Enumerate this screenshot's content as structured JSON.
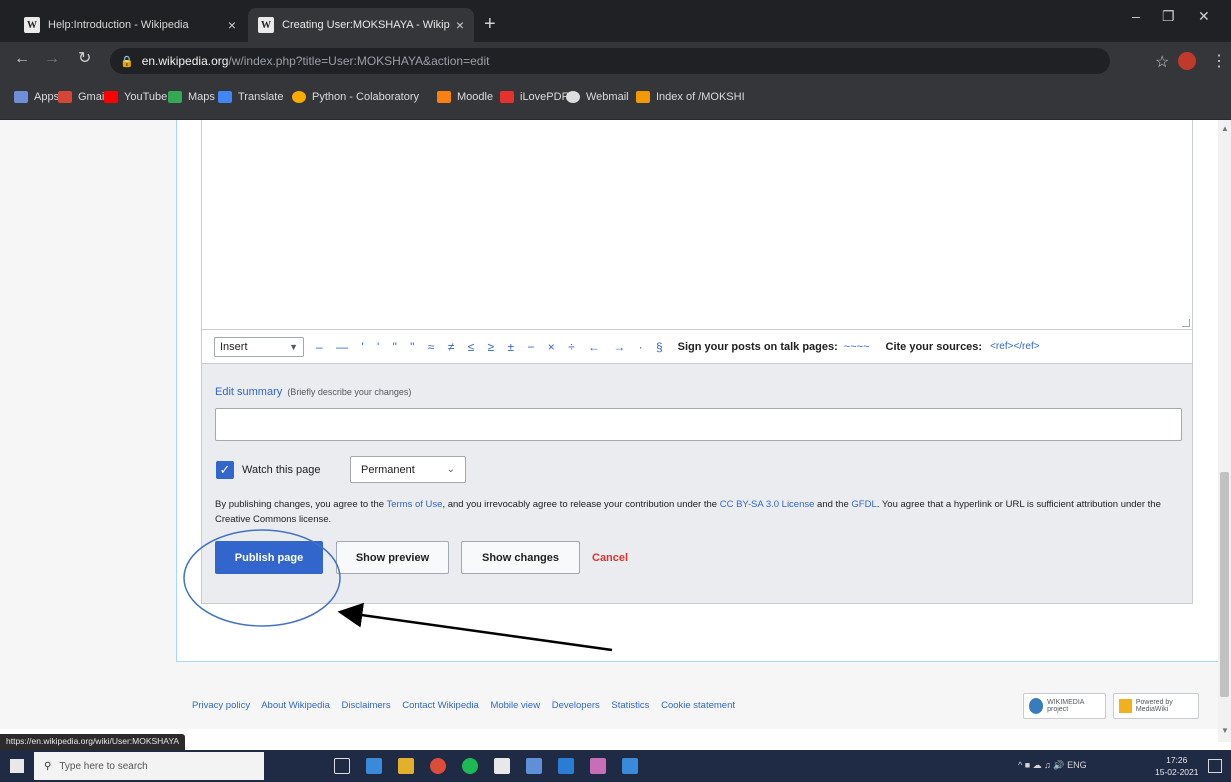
{
  "browser": {
    "tabs": [
      {
        "title": "Help:Introduction - Wikipedia",
        "favicon": "W",
        "close": "×"
      },
      {
        "title": "Creating User:MOKSHAYA - Wikip",
        "favicon": "W",
        "close": "×"
      }
    ],
    "new_tab": "+",
    "url_domain": "en.wikipedia.org",
    "url_path": "/w/index.php?title=User:MOKSHAYA&action=edit",
    "bookmarks": [
      {
        "label": "Apps",
        "color": "#6f8ed8"
      },
      {
        "label": "Gmail",
        "color": "#d44638"
      },
      {
        "label": "YouTube",
        "color": "#ff0000"
      },
      {
        "label": "Maps",
        "color": "#34a853"
      },
      {
        "label": "Translate",
        "color": "#4285f4"
      },
      {
        "label": "Python - Colaboratory",
        "color": "#f9ab00"
      },
      {
        "label": "Moodle",
        "color": "#f98012"
      },
      {
        "label": "iLovePDF",
        "color": "#e5322d"
      },
      {
        "label": "Webmail",
        "color": "#dddddd"
      },
      {
        "label": "Index of /MOKSHI",
        "color": "#f29900"
      }
    ]
  },
  "editor": {
    "insert_select": "Insert",
    "special_chars": "– — ' ' \" \" ≈ ≠ ≤ ≥ ± − × ÷ ← → · §",
    "sign_label": "Sign your posts on talk pages:",
    "sign_value": "~~~~",
    "cite_label": "Cite your sources:",
    "cite_value": "<ref></ref>"
  },
  "summary": {
    "label": "Edit summary",
    "hint": "(Briefly describe your changes)",
    "value": ""
  },
  "watch": {
    "checked": true,
    "label": "Watch this page",
    "period": "Permanent"
  },
  "license": {
    "t1": "By publishing changes, you agree to the ",
    "terms": "Terms of Use",
    "t2": ", and you irrevocably agree to release your contribution under the ",
    "cc": "CC BY-SA 3.0 License",
    "t3": " and the ",
    "gfdl": "GFDL",
    "t4": ". You agree that a hyperlink or URL is sufficient attribution under the Creative Commons license."
  },
  "buttons": {
    "publish": "Publish page",
    "preview": "Show preview",
    "changes": "Show changes",
    "cancel": "Cancel"
  },
  "footer": {
    "links": [
      "Privacy policy",
      "About Wikipedia",
      "Disclaimers",
      "Contact Wikipedia",
      "Mobile view",
      "Developers",
      "Statistics",
      "Cookie statement"
    ],
    "wikimedia_badge": "WIKIMEDIA project",
    "mediawiki_badge": "Powered by MediaWiki"
  },
  "status_url": "https://en.wikipedia.org/wiki/User:MOKSHAYA",
  "taskbar": {
    "search_placeholder": "Type here to search",
    "lang": "ENG",
    "time": "17:26",
    "date": "15-02-2021"
  },
  "colors": {
    "accent": "#3366cc",
    "cancel": "#dd3333",
    "annotation": "#4472c4"
  }
}
